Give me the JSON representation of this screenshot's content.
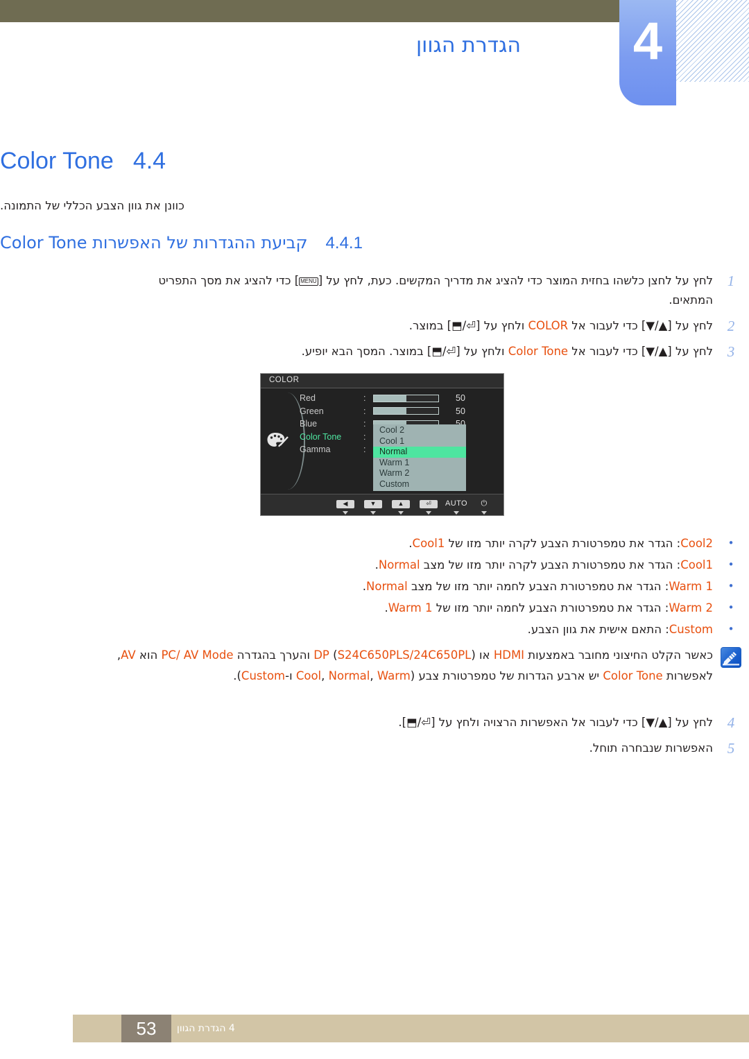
{
  "header": {
    "chapter_number": "4",
    "chapter_title": "הגדרת הגוון"
  },
  "section": {
    "number": "4.4",
    "title": "Color Tone",
    "intro": "כוונן את גוון הצבע הכללי של התמונה.",
    "sub_number": "4.4.1",
    "sub_title": "קביעת ההגדרות של האפשרות Color Tone"
  },
  "steps": [
    {
      "num": "1",
      "parts": [
        {
          "t": "לחץ על לחצן כלשהו בחזית המוצר כדי להציג את מדריך המקשים. כעת, לחץ על [",
          "k": ""
        },
        {
          "key": "MENU"
        },
        {
          "t": "] כדי להציג את מסך התפריט המתאים."
        }
      ]
    },
    {
      "num": "2",
      "parts": [
        {
          "t": "לחץ על [▲/▼] כדי לעבור אל "
        },
        {
          "o": "COLOR"
        },
        {
          "t": " ולחץ על [⏎/⬒] במוצר."
        }
      ]
    },
    {
      "num": "3",
      "parts": [
        {
          "t": "לחץ על [▲/▼] כדי לעבור אל "
        },
        {
          "o": "Color Tone"
        },
        {
          "t": " ולחץ על [⏎/⬒] במוצר. המסך הבא יופיע."
        }
      ]
    }
  ],
  "steps_tail": [
    {
      "num": "4",
      "parts": [
        {
          "t": "לחץ על [▲/▼] כדי לעבור אל האפשרות הרצויה ולחץ על [⏎/⬒]."
        }
      ]
    },
    {
      "num": "5",
      "parts": [
        {
          "t": "האפשרות שנבחרה תוחל."
        }
      ]
    }
  ],
  "osd": {
    "title": "COLOR",
    "icon": "palette-icon",
    "rows": [
      {
        "label": "Red",
        "colon": ":",
        "value": "50",
        "fill_pct": 50,
        "type": "slider",
        "active": false
      },
      {
        "label": "Green",
        "colon": ":",
        "value": "50",
        "fill_pct": 50,
        "type": "slider",
        "active": false
      },
      {
        "label": "Blue",
        "colon": ":",
        "value": "50",
        "fill_pct": 50,
        "type": "slider",
        "active": false
      },
      {
        "label": "Color Tone",
        "colon": ":",
        "value": "",
        "type": "dropdown",
        "active": true
      },
      {
        "label": "Gamma",
        "colon": ":",
        "value": "",
        "type": "none",
        "active": false
      }
    ],
    "dropdown_options": [
      "Cool 2",
      "Cool 1",
      "Normal",
      "Warm 1",
      "Warm 2",
      "Custom"
    ],
    "dropdown_selected": "Normal",
    "footer_buttons": [
      "◀",
      "▼",
      "▲",
      "⏎",
      "AUTO",
      "⏻"
    ],
    "colors": {
      "highlight": "#4ee5a0",
      "panel": "#222222",
      "dropdown_bg": "#9fb3b2"
    }
  },
  "bullets": [
    {
      "parts": [
        {
          "o": "Cool2"
        },
        {
          "t": ": הגדר את טמפרטורת הצבע לקרה יותר מזו של "
        },
        {
          "o": "Cool1"
        },
        {
          "t": "."
        }
      ]
    },
    {
      "parts": [
        {
          "o": "Cool1"
        },
        {
          "t": ": הגדר את טמפרטורת הצבע לקרה יותר מזו של מצב "
        },
        {
          "o": "Normal"
        },
        {
          "t": "."
        }
      ]
    },
    {
      "parts": [
        {
          "o": "Warm 1"
        },
        {
          "t": ": הגדר את טמפרטורת הצבע לחמה יותר מזו של מצב "
        },
        {
          "o": "Normal"
        },
        {
          "t": "."
        }
      ]
    },
    {
      "parts": [
        {
          "o": "Warm 2"
        },
        {
          "t": ": הגדר את טמפרטורת הצבע לחמה יותר מזו של "
        },
        {
          "o": "Warm 1"
        },
        {
          "t": "."
        }
      ]
    },
    {
      "parts": [
        {
          "o": "Custom"
        },
        {
          "t": ": התאם אישית את גוון הצבע."
        }
      ]
    }
  ],
  "note": {
    "icon": "note-pencil-icon",
    "parts": [
      {
        "t": "כאשר הקלט החיצוני מחובר באמצעות "
      },
      {
        "o": "HDMI"
      },
      {
        "t": " או "
      },
      {
        "o": "DP"
      },
      {
        "t": " ("
      },
      {
        "o": "S24C650PLS/24C650PL"
      },
      {
        "t": ") והערך בהגדרה "
      },
      {
        "o": "PC/ AV Mode"
      },
      {
        "t": " הוא "
      },
      {
        "o": "AV"
      },
      {
        "t": ", לאפשרות "
      },
      {
        "o": "Color Tone"
      },
      {
        "t": " יש ארבע הגדרות של טמפרטורת צבע ("
      },
      {
        "o": "Cool"
      },
      {
        "t": ", "
      },
      {
        "o": "Normal"
      },
      {
        "t": ", "
      },
      {
        "o": "Warm"
      },
      {
        "t": " ו-"
      },
      {
        "o": "Custom"
      },
      {
        "t": ")."
      }
    ]
  },
  "footer": {
    "page_number": "53",
    "text": "4 הגדרת הגוון"
  }
}
